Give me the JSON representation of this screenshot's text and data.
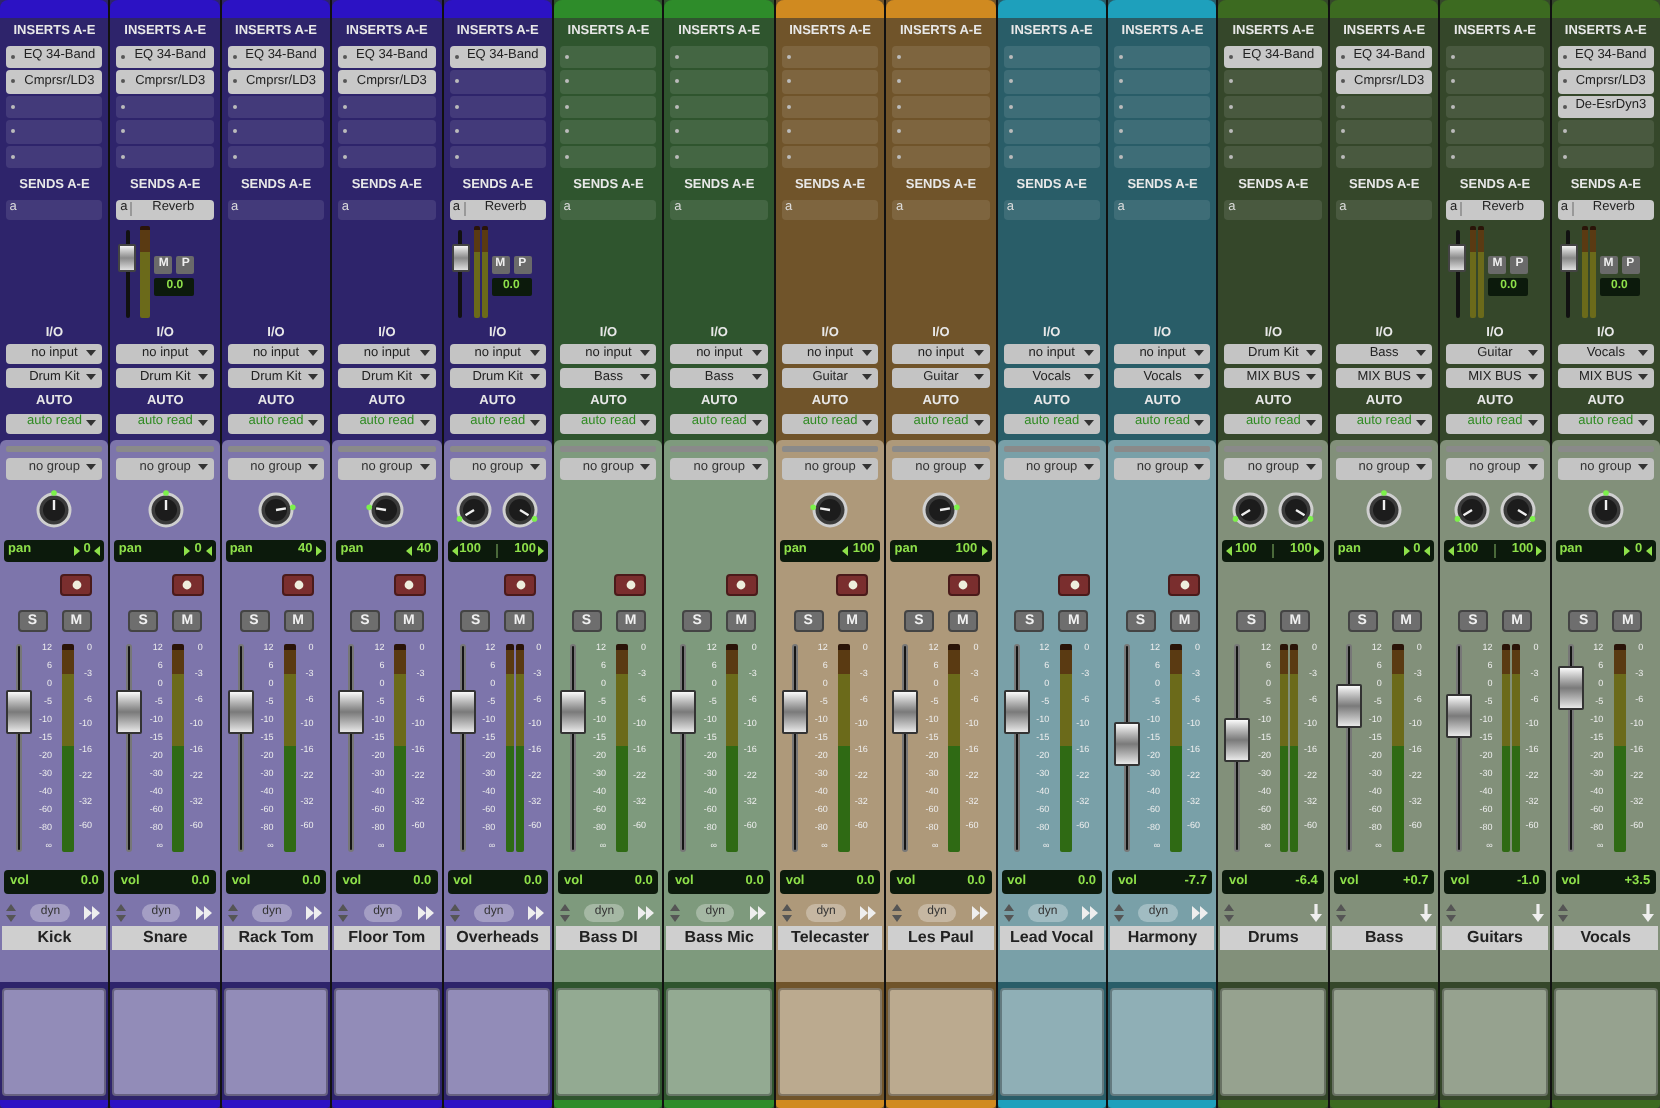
{
  "strips": [
    {
      "name": "Kick",
      "kind": "audio",
      "color": "#2c12c4",
      "inserts_label": "INSERTS A-E",
      "inserts": [
        "EQ 34-Band",
        "Cmprsr/LD3"
      ],
      "sends_label": "SENDS A-E",
      "send": {
        "slot": "a"
      },
      "io_label": "I/O",
      "input": "no input",
      "output": "Drum Kit",
      "auto_label": "AUTO",
      "automation": "auto read",
      "group": "no group",
      "pan": {
        "kind": "mono",
        "label": "pan",
        "value": "0",
        "left_arrow": true,
        "right_arrow": true
      },
      "solo": "S",
      "mute": "M",
      "fader": {
        "level": 0.72,
        "scale": [
          "12",
          "6",
          "0",
          "-5",
          "-10",
          "-15",
          "-20",
          "-30",
          "-40",
          "-60",
          "-80",
          "∞"
        ]
      },
      "meter": {
        "stereo": false,
        "scale": [
          "0",
          "-3",
          "-6",
          "-10",
          "-16",
          "-22",
          "-32",
          "-60"
        ]
      },
      "vol": {
        "label": "vol",
        "value": "0.0"
      },
      "dyn": "dyn"
    },
    {
      "name": "Snare",
      "kind": "audio",
      "color": "#2c12c4",
      "inserts_label": "INSERTS A-E",
      "inserts": [
        "EQ 34-Band",
        "Cmprsr/LD3"
      ],
      "sends_label": "SENDS A-E",
      "send": {
        "slot": "a",
        "name": "Reverb",
        "level": 0.75,
        "stereo": false,
        "mute": "M",
        "prepost": "P",
        "value": "0.0"
      },
      "io_label": "I/O",
      "input": "no input",
      "output": "Drum Kit",
      "auto_label": "AUTO",
      "automation": "auto read",
      "group": "no group",
      "pan": {
        "kind": "mono",
        "label": "pan",
        "value": "0",
        "left_arrow": true,
        "right_arrow": true
      },
      "solo": "S",
      "mute": "M",
      "fader": {
        "level": 0.72,
        "scale": [
          "12",
          "6",
          "0",
          "-5",
          "-10",
          "-15",
          "-20",
          "-30",
          "-40",
          "-60",
          "-80",
          "∞"
        ]
      },
      "meter": {
        "stereo": false,
        "scale": [
          "0",
          "-3",
          "-6",
          "-10",
          "-16",
          "-22",
          "-32",
          "-60"
        ]
      },
      "vol": {
        "label": "vol",
        "value": "0.0"
      },
      "dyn": "dyn"
    },
    {
      "name": "Rack Tom",
      "kind": "audio",
      "color": "#2c12c4",
      "inserts_label": "INSERTS A-E",
      "inserts": [
        "EQ 34-Band",
        "Cmprsr/LD3"
      ],
      "sends_label": "SENDS A-E",
      "send": {
        "slot": "a"
      },
      "io_label": "I/O",
      "input": "no input",
      "output": "Drum Kit",
      "auto_label": "AUTO",
      "automation": "auto read",
      "group": "no group",
      "pan": {
        "kind": "mono",
        "label": "pan",
        "value": "40",
        "left_arrow": false,
        "right_arrow": true
      },
      "solo": "S",
      "mute": "M",
      "fader": {
        "level": 0.72,
        "scale": [
          "12",
          "6",
          "0",
          "-5",
          "-10",
          "-15",
          "-20",
          "-30",
          "-40",
          "-60",
          "-80",
          "∞"
        ]
      },
      "meter": {
        "stereo": false,
        "scale": [
          "0",
          "-3",
          "-6",
          "-10",
          "-16",
          "-22",
          "-32",
          "-60"
        ]
      },
      "vol": {
        "label": "vol",
        "value": "0.0"
      },
      "dyn": "dyn"
    },
    {
      "name": "Floor Tom",
      "kind": "audio",
      "color": "#2c12c4",
      "inserts_label": "INSERTS A-E",
      "inserts": [
        "EQ 34-Band",
        "Cmprsr/LD3"
      ],
      "sends_label": "SENDS A-E",
      "send": {
        "slot": "a"
      },
      "io_label": "I/O",
      "input": "no input",
      "output": "Drum Kit",
      "auto_label": "AUTO",
      "automation": "auto read",
      "group": "no group",
      "pan": {
        "kind": "mono",
        "label": "pan",
        "value": "40",
        "left_arrow": true,
        "right_arrow": false
      },
      "solo": "S",
      "mute": "M",
      "fader": {
        "level": 0.72,
        "scale": [
          "12",
          "6",
          "0",
          "-5",
          "-10",
          "-15",
          "-20",
          "-30",
          "-40",
          "-60",
          "-80",
          "∞"
        ]
      },
      "meter": {
        "stereo": false,
        "scale": [
          "0",
          "-3",
          "-6",
          "-10",
          "-16",
          "-22",
          "-32",
          "-60"
        ]
      },
      "vol": {
        "label": "vol",
        "value": "0.0"
      },
      "dyn": "dyn"
    },
    {
      "name": "Overheads",
      "kind": "audio",
      "color": "#2c12c4",
      "inserts_label": "INSERTS A-E",
      "inserts": [
        "EQ 34-Band"
      ],
      "sends_label": "SENDS A-E",
      "send": {
        "slot": "a",
        "name": "Reverb",
        "level": 0.75,
        "stereo": true,
        "mute": "M",
        "prepost": "P",
        "value": "0.0"
      },
      "io_label": "I/O",
      "input": "no input",
      "output": "Drum Kit",
      "auto_label": "AUTO",
      "automation": "auto read",
      "group": "no group",
      "pan": {
        "kind": "stereo",
        "values": [
          "100",
          "100"
        ]
      },
      "solo": "S",
      "mute": "M",
      "fader": {
        "level": 0.72,
        "scale": [
          "12",
          "6",
          "0",
          "-5",
          "-10",
          "-15",
          "-20",
          "-30",
          "-40",
          "-60",
          "-80",
          "∞"
        ]
      },
      "meter": {
        "stereo": true,
        "scale": [
          "0",
          "-3",
          "-6",
          "-10",
          "-16",
          "-22",
          "-32",
          "-60"
        ]
      },
      "vol": {
        "label": "vol",
        "value": "0.0"
      },
      "dyn": "dyn"
    },
    {
      "name": "Bass DI",
      "kind": "audio",
      "color": "#2e8c2a",
      "inserts_label": "INSERTS A-E",
      "sends_label": "SENDS A-E",
      "send": {
        "slot": "a"
      },
      "io_label": "I/O",
      "input": "no input",
      "output": "Bass",
      "auto_label": "AUTO",
      "automation": "auto read",
      "group": "no group",
      "solo": "S",
      "mute": "M",
      "fader": {
        "level": 0.72,
        "scale": [
          "12",
          "6",
          "0",
          "-5",
          "-10",
          "-15",
          "-20",
          "-30",
          "-40",
          "-60",
          "-80",
          "∞"
        ]
      },
      "meter": {
        "stereo": false,
        "scale": [
          "0",
          "-3",
          "-6",
          "-10",
          "-16",
          "-22",
          "-32",
          "-60"
        ]
      },
      "vol": {
        "label": "vol",
        "value": "0.0"
      },
      "dyn": "dyn"
    },
    {
      "name": "Bass Mic",
      "kind": "audio",
      "color": "#2e8c2a",
      "inserts_label": "INSERTS A-E",
      "sends_label": "SENDS A-E",
      "send": {
        "slot": "a"
      },
      "io_label": "I/O",
      "input": "no input",
      "output": "Bass",
      "auto_label": "AUTO",
      "automation": "auto read",
      "group": "no group",
      "solo": "S",
      "mute": "M",
      "fader": {
        "level": 0.72,
        "scale": [
          "12",
          "6",
          "0",
          "-5",
          "-10",
          "-15",
          "-20",
          "-30",
          "-40",
          "-60",
          "-80",
          "∞"
        ]
      },
      "meter": {
        "stereo": false,
        "scale": [
          "0",
          "-3",
          "-6",
          "-10",
          "-16",
          "-22",
          "-32",
          "-60"
        ]
      },
      "vol": {
        "label": "vol",
        "value": "0.0"
      },
      "dyn": "dyn"
    },
    {
      "name": "Telecaster",
      "kind": "audio",
      "color": "#d08a20",
      "inserts_label": "INSERTS A-E",
      "sends_label": "SENDS A-E",
      "send": {
        "slot": "a"
      },
      "io_label": "I/O",
      "input": "no input",
      "output": "Guitar",
      "auto_label": "AUTO",
      "automation": "auto read",
      "group": "no group",
      "pan": {
        "kind": "mono",
        "label": "pan",
        "value": "100",
        "left_arrow": true,
        "right_arrow": false
      },
      "solo": "S",
      "mute": "M",
      "fader": {
        "level": 0.72,
        "scale": [
          "12",
          "6",
          "0",
          "-5",
          "-10",
          "-15",
          "-20",
          "-30",
          "-40",
          "-60",
          "-80",
          "∞"
        ]
      },
      "meter": {
        "stereo": false,
        "scale": [
          "0",
          "-3",
          "-6",
          "-10",
          "-16",
          "-22",
          "-32",
          "-60"
        ]
      },
      "vol": {
        "label": "vol",
        "value": "0.0"
      },
      "dyn": "dyn"
    },
    {
      "name": "Les Paul",
      "kind": "audio",
      "color": "#d08a20",
      "inserts_label": "INSERTS A-E",
      "sends_label": "SENDS A-E",
      "send": {
        "slot": "a"
      },
      "io_label": "I/O",
      "input": "no input",
      "output": "Guitar",
      "auto_label": "AUTO",
      "automation": "auto read",
      "group": "no group",
      "pan": {
        "kind": "mono",
        "label": "pan",
        "value": "100",
        "left_arrow": false,
        "right_arrow": true
      },
      "solo": "S",
      "mute": "M",
      "fader": {
        "level": 0.72,
        "scale": [
          "12",
          "6",
          "0",
          "-5",
          "-10",
          "-15",
          "-20",
          "-30",
          "-40",
          "-60",
          "-80",
          "∞"
        ]
      },
      "meter": {
        "stereo": false,
        "scale": [
          "0",
          "-3",
          "-6",
          "-10",
          "-16",
          "-22",
          "-32",
          "-60"
        ]
      },
      "vol": {
        "label": "vol",
        "value": "0.0"
      },
      "dyn": "dyn"
    },
    {
      "name": "Lead Vocal",
      "kind": "audio",
      "color": "#1ea0bc",
      "inserts_label": "INSERTS A-E",
      "sends_label": "SENDS A-E",
      "send": {
        "slot": "a"
      },
      "io_label": "I/O",
      "input": "no input",
      "output": "Vocals",
      "auto_label": "AUTO",
      "automation": "auto read",
      "group": "no group",
      "solo": "S",
      "mute": "M",
      "fader": {
        "level": 0.72,
        "scale": [
          "12",
          "6",
          "0",
          "-5",
          "-10",
          "-15",
          "-20",
          "-30",
          "-40",
          "-60",
          "-80",
          "∞"
        ]
      },
      "meter": {
        "stereo": false,
        "scale": [
          "0",
          "-3",
          "-6",
          "-10",
          "-16",
          "-22",
          "-32",
          "-60"
        ]
      },
      "vol": {
        "label": "vol",
        "value": "0.0"
      },
      "dyn": "dyn"
    },
    {
      "name": "Harmony",
      "kind": "audio",
      "color": "#1ea0bc",
      "inserts_label": "INSERTS A-E",
      "sends_label": "SENDS A-E",
      "send": {
        "slot": "a"
      },
      "io_label": "I/O",
      "input": "no input",
      "output": "Vocals",
      "auto_label": "AUTO",
      "automation": "auto read",
      "group": "no group",
      "solo": "S",
      "mute": "M",
      "fader": {
        "level": 0.52,
        "scale": [
          "12",
          "6",
          "0",
          "-5",
          "-10",
          "-15",
          "-20",
          "-30",
          "-40",
          "-60",
          "-80",
          "∞"
        ]
      },
      "meter": {
        "stereo": false,
        "scale": [
          "0",
          "-3",
          "-6",
          "-10",
          "-16",
          "-22",
          "-32",
          "-60"
        ]
      },
      "vol": {
        "label": "vol",
        "value": "-7.7"
      },
      "dyn": "dyn"
    },
    {
      "name": "Drums",
      "kind": "aux",
      "color": "#3c6a20",
      "inserts_label": "INSERTS A-E",
      "inserts": [
        "EQ 34-Band"
      ],
      "sends_label": "SENDS A-E",
      "send": {
        "slot": "a"
      },
      "io_label": "I/O",
      "input": "Drum Kit",
      "output": "MIX BUS",
      "auto_label": "AUTO",
      "automation": "auto read",
      "group": "no group",
      "pan": {
        "kind": "stereo",
        "values": [
          "100",
          "100"
        ]
      },
      "solo": "S",
      "mute": "M",
      "fader": {
        "level": 0.55,
        "scale": [
          "12",
          "6",
          "0",
          "-5",
          "-10",
          "-15",
          "-20",
          "-30",
          "-40",
          "-60",
          "-80",
          "∞"
        ]
      },
      "meter": {
        "stereo": true,
        "scale": [
          "0",
          "-3",
          "-6",
          "-10",
          "-16",
          "-22",
          "-32",
          "-60"
        ]
      },
      "vol": {
        "label": "vol",
        "value": "-6.4"
      }
    },
    {
      "name": "Bass",
      "kind": "aux",
      "color": "#3c6a20",
      "inserts_label": "INSERTS A-E",
      "inserts": [
        "EQ 34-Band",
        "Cmprsr/LD3"
      ],
      "sends_label": "SENDS A-E",
      "send": {
        "slot": "a"
      },
      "io_label": "I/O",
      "input": "Bass",
      "output": "MIX BUS",
      "auto_label": "AUTO",
      "automation": "auto read",
      "group": "no group",
      "pan": {
        "kind": "mono",
        "label": "pan",
        "value": "0",
        "left_arrow": true,
        "right_arrow": true
      },
      "solo": "S",
      "mute": "M",
      "fader": {
        "level": 0.76,
        "scale": [
          "12",
          "6",
          "0",
          "-5",
          "-10",
          "-15",
          "-20",
          "-30",
          "-40",
          "-60",
          "-80",
          "∞"
        ]
      },
      "meter": {
        "stereo": false,
        "scale": [
          "0",
          "-3",
          "-6",
          "-10",
          "-16",
          "-22",
          "-32",
          "-60"
        ]
      },
      "vol": {
        "label": "vol",
        "value": "+0.7"
      }
    },
    {
      "name": "Guitars",
      "kind": "aux",
      "color": "#3c6a20",
      "inserts_label": "INSERTS A-E",
      "sends_label": "SENDS A-E",
      "send": {
        "slot": "a",
        "name": "Reverb",
        "level": 0.75,
        "stereo": true,
        "mute": "M",
        "prepost": "P",
        "value": "0.0"
      },
      "io_label": "I/O",
      "input": "Guitar",
      "output": "MIX BUS",
      "auto_label": "AUTO",
      "automation": "auto read",
      "group": "no group",
      "pan": {
        "kind": "stereo",
        "values": [
          "100",
          "100"
        ]
      },
      "solo": "S",
      "mute": "M",
      "fader": {
        "level": 0.69,
        "scale": [
          "12",
          "6",
          "0",
          "-5",
          "-10",
          "-15",
          "-20",
          "-30",
          "-40",
          "-60",
          "-80",
          "∞"
        ]
      },
      "meter": {
        "stereo": true,
        "scale": [
          "0",
          "-3",
          "-6",
          "-10",
          "-16",
          "-22",
          "-32",
          "-60"
        ]
      },
      "vol": {
        "label": "vol",
        "value": "-1.0"
      }
    },
    {
      "name": "Vocals",
      "kind": "aux",
      "color": "#3c6a20",
      "inserts_label": "INSERTS A-E",
      "inserts": [
        "EQ 34-Band",
        "Cmprsr/LD3",
        "De-EsrDyn3"
      ],
      "sends_label": "SENDS A-E",
      "send": {
        "slot": "a",
        "name": "Reverb",
        "level": 0.75,
        "stereo": true,
        "mute": "M",
        "prepost": "P",
        "value": "0.0"
      },
      "io_label": "I/O",
      "input": "Vocals",
      "output": "MIX BUS",
      "auto_label": "AUTO",
      "automation": "auto read",
      "group": "no group",
      "pan": {
        "kind": "mono",
        "label": "pan",
        "value": "0",
        "left_arrow": true,
        "right_arrow": true
      },
      "solo": "S",
      "mute": "M",
      "fader": {
        "level": 0.86,
        "scale": [
          "12",
          "6",
          "0",
          "-5",
          "-10",
          "-15",
          "-20",
          "-30",
          "-40",
          "-60",
          "-80",
          "∞"
        ]
      },
      "meter": {
        "stereo": false,
        "scale": [
          "0",
          "-3",
          "-6",
          "-10",
          "-16",
          "-22",
          "-32",
          "-60"
        ]
      },
      "vol": {
        "label": "vol",
        "value": "+3.5"
      }
    }
  ]
}
